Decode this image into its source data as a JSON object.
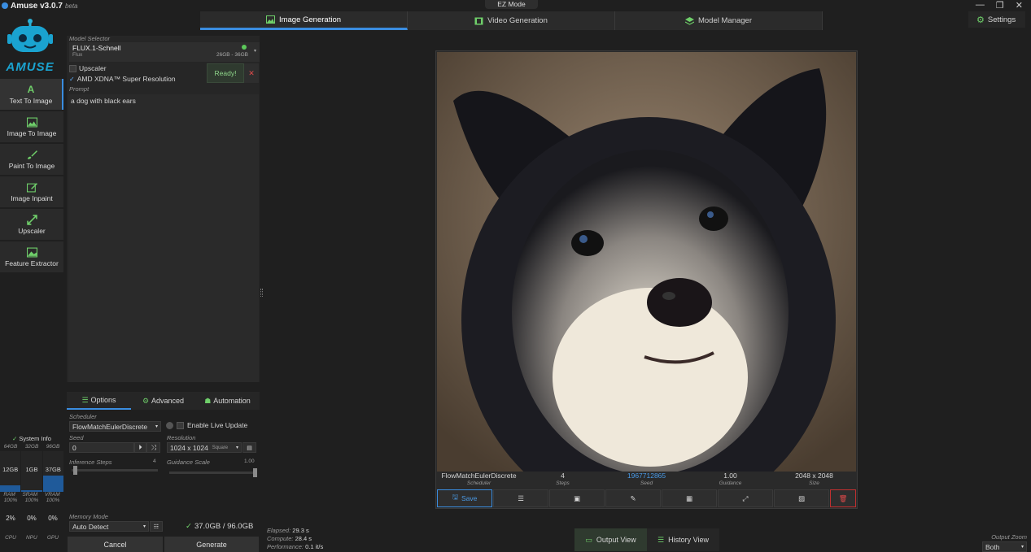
{
  "app": {
    "title": "Amuse v3.0.7",
    "badge": "beta",
    "ez_mode": "EZ Mode",
    "logo_text": "AMUSE",
    "settings": "Settings"
  },
  "tabs": [
    {
      "label": "Image Generation"
    },
    {
      "label": "Video Generation"
    },
    {
      "label": "Model Manager"
    }
  ],
  "nav": [
    {
      "label": "Text To Image"
    },
    {
      "label": "Image To Image"
    },
    {
      "label": "Paint To Image"
    },
    {
      "label": "Image Inpaint"
    },
    {
      "label": "Upscaler"
    },
    {
      "label": "Feature Extractor"
    }
  ],
  "model": {
    "section_label": "Model Selector",
    "name": "FLUX.1-Schnell",
    "type": "Flux",
    "vram": "26GB - 36GB",
    "status": "Ready!"
  },
  "options": {
    "upscaler": "Upscaler",
    "super_res": "AMD XDNA™ Super Resolution",
    "prompt_label": "Prompt",
    "prompt_value": "a dog with black ears"
  },
  "subtabs": [
    {
      "label": "Options"
    },
    {
      "label": "Advanced"
    },
    {
      "label": "Automation"
    }
  ],
  "settings": {
    "scheduler_label": "Scheduler",
    "scheduler": "FlowMatchEulerDiscrete",
    "live_update": "Enable Live Update",
    "seed_label": "Seed",
    "seed": "0",
    "resolution_label": "Resolution",
    "resolution": "1024 x 1024",
    "resolution_hint": "Square",
    "steps_label": "Inference Steps",
    "steps": "4",
    "guidance_label": "Guidance Scale",
    "guidance": "1.00",
    "memory_label": "Memory Mode",
    "memory": "Auto Detect",
    "memory_usage": "37.0GB / 96.0GB"
  },
  "system": {
    "title": "System Info",
    "caps": [
      "64GB",
      "32GB",
      "96GB"
    ],
    "used": [
      "12GB",
      "1GB",
      "37GB"
    ],
    "names": [
      "RAM",
      "SRAM",
      "VRAM"
    ],
    "pcts": [
      "100%",
      "100%",
      "100%"
    ],
    "loads": [
      "2%",
      "0%",
      "0%"
    ],
    "units": [
      "CPU",
      "NPU",
      "GPU"
    ]
  },
  "buttons": {
    "cancel": "Cancel",
    "generate": "Generate"
  },
  "result": {
    "scheduler": "FlowMatchEulerDiscrete",
    "scheduler_label": "Scheduler",
    "steps": "4",
    "steps_label": "Steps",
    "seed": "1967712865",
    "seed_label": "Seed",
    "guidance": "1.00",
    "guidance_label": "Guidance",
    "size": "2048 x 2048",
    "size_label": "Size",
    "save": "Save"
  },
  "stats": {
    "elapsed_label": "Elapsed:",
    "elapsed": "29.3 s",
    "compute_label": "Compute:",
    "compute": "28.4 s",
    "perf_label": "Performance:",
    "perf": "0.1 it/s"
  },
  "views": {
    "output": "Output View",
    "history": "History View"
  },
  "zoom": {
    "label": "Output Zoom",
    "value": "Both"
  }
}
